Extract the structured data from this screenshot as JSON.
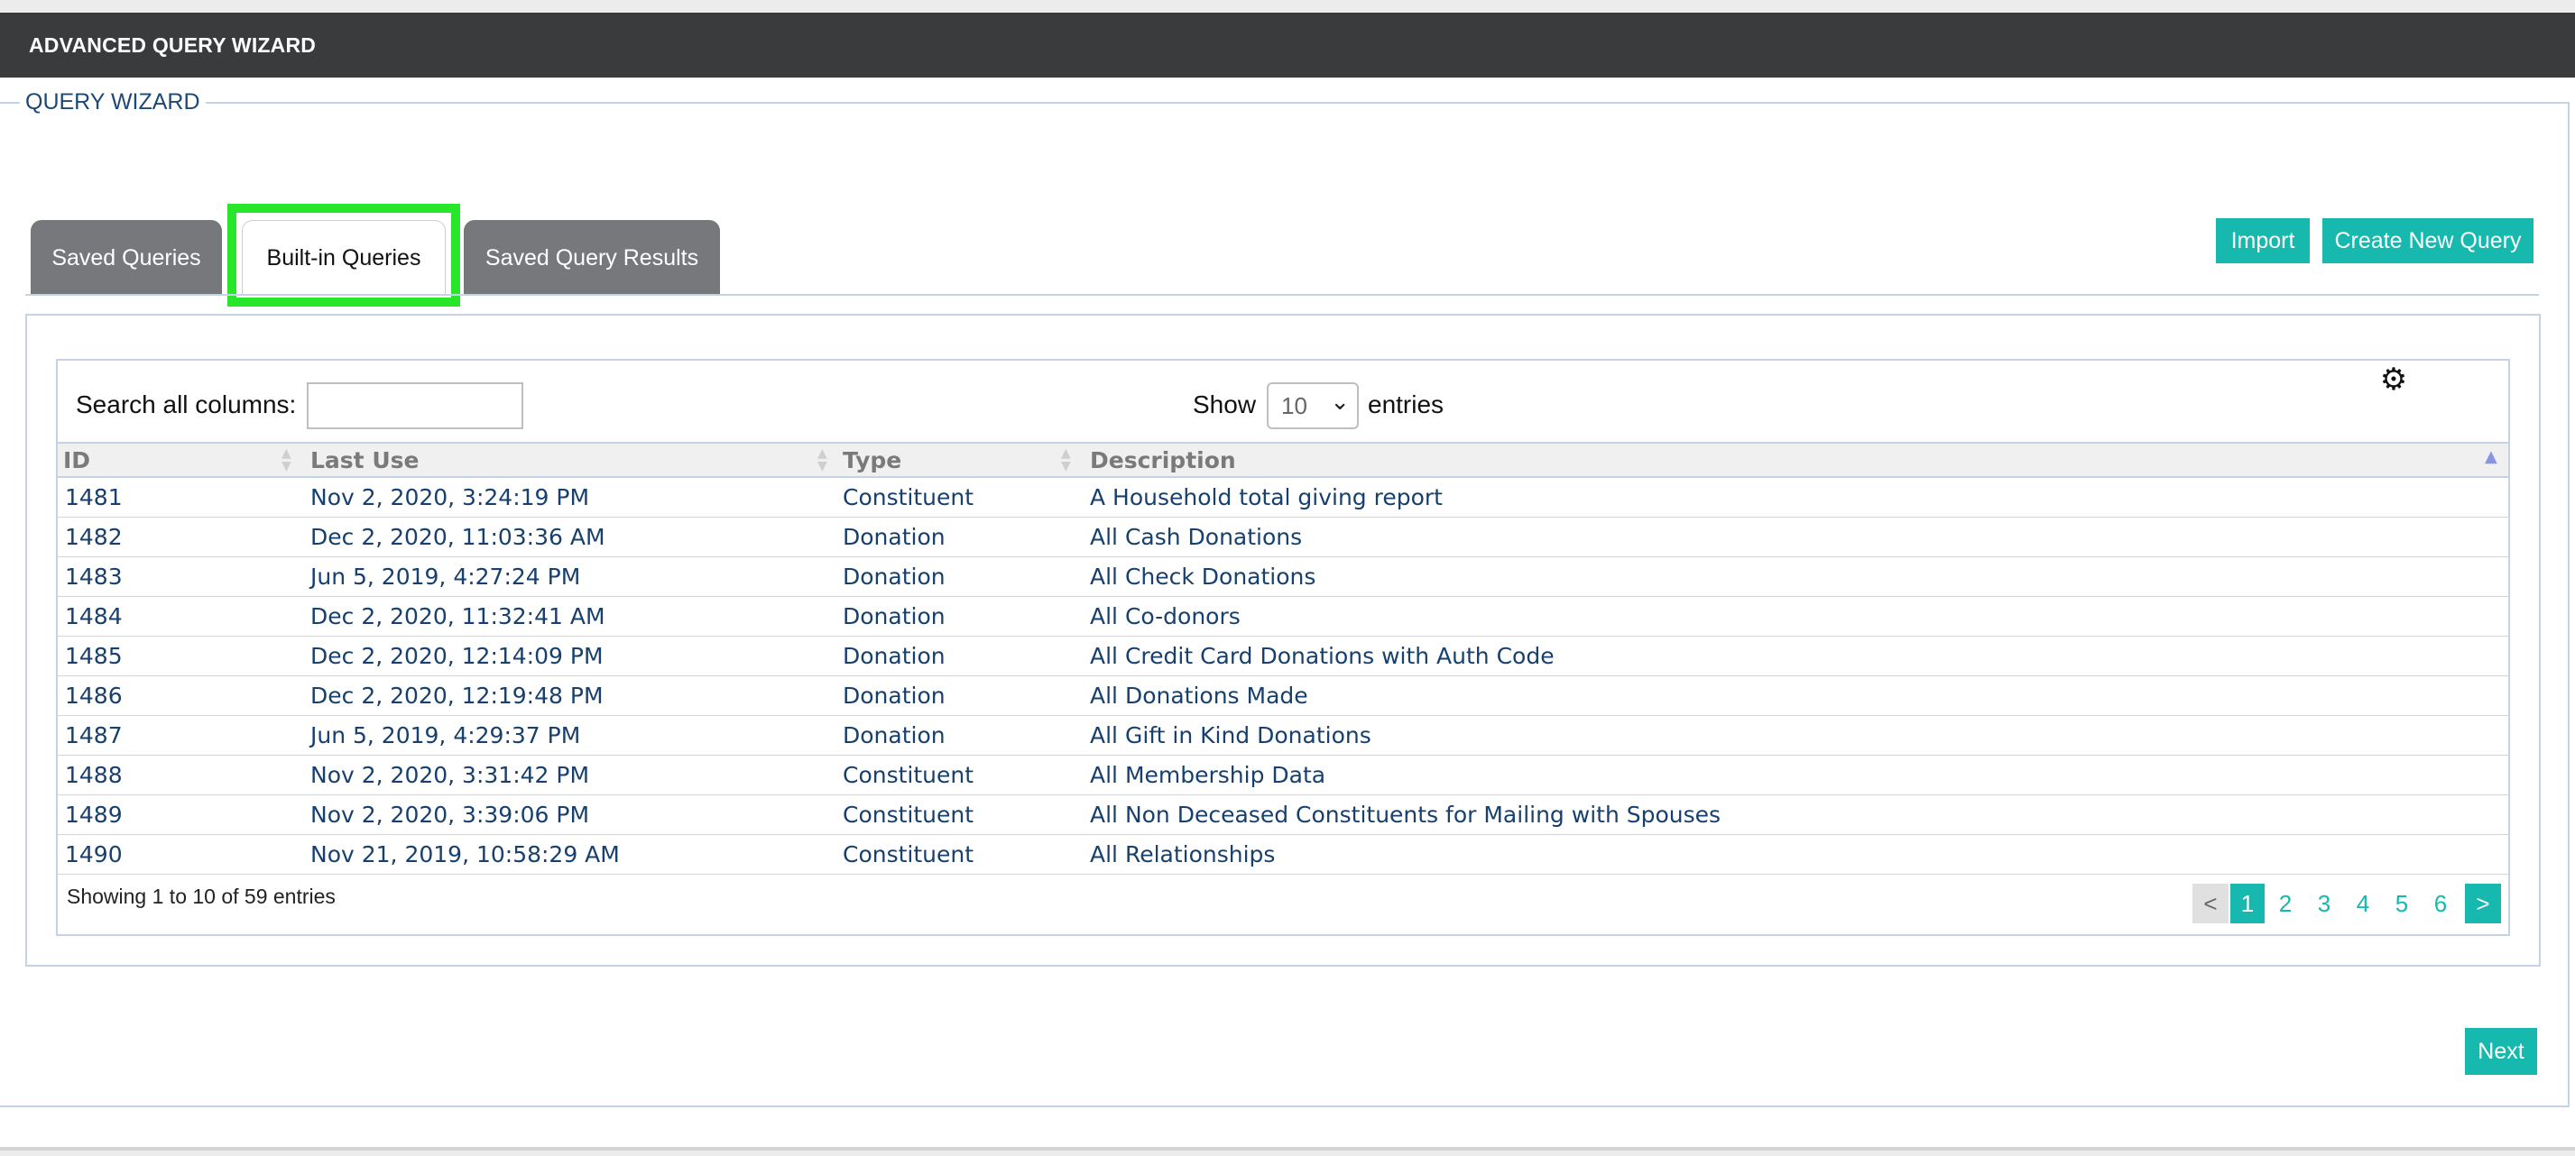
{
  "header": {
    "title": "ADVANCED QUERY WIZARD"
  },
  "wizard": {
    "legend": "QUERY WIZARD"
  },
  "tabs": [
    {
      "label": "Saved Queries",
      "active": false
    },
    {
      "label": "Built-in Queries",
      "active": true
    },
    {
      "label": "Saved Query Results",
      "active": false
    }
  ],
  "actions": {
    "import_label": "Import",
    "create_label": "Create New Query",
    "next_label": "Next"
  },
  "table_controls": {
    "search_label": "Search all columns:",
    "search_value": "",
    "show_label": "Show",
    "page_size": "10",
    "entries_label": "entries",
    "settings_icon": "gear-icon"
  },
  "table": {
    "columns": [
      "ID",
      "Last Use",
      "Type",
      "Description"
    ],
    "rows": [
      {
        "id": "1481",
        "last_use": "Nov 2, 2020, 3:24:19 PM",
        "type": "Constituent",
        "description": "A Household total giving report"
      },
      {
        "id": "1482",
        "last_use": "Dec 2, 2020, 11:03:36 AM",
        "type": "Donation",
        "description": "All Cash Donations"
      },
      {
        "id": "1483",
        "last_use": "Jun 5, 2019, 4:27:24 PM",
        "type": "Donation",
        "description": "All Check Donations"
      },
      {
        "id": "1484",
        "last_use": "Dec 2, 2020, 11:32:41 AM",
        "type": "Donation",
        "description": "All Co-donors"
      },
      {
        "id": "1485",
        "last_use": "Dec 2, 2020, 12:14:09 PM",
        "type": "Donation",
        "description": "All Credit Card Donations with Auth Code"
      },
      {
        "id": "1486",
        "last_use": "Dec 2, 2020, 12:19:48 PM",
        "type": "Donation",
        "description": "All Donations Made"
      },
      {
        "id": "1487",
        "last_use": "Jun 5, 2019, 4:29:37 PM",
        "type": "Donation",
        "description": "All Gift in Kind Donations"
      },
      {
        "id": "1488",
        "last_use": "Nov 2, 2020, 3:31:42 PM",
        "type": "Constituent",
        "description": "All Membership Data"
      },
      {
        "id": "1489",
        "last_use": "Nov 2, 2020, 3:39:06 PM",
        "type": "Constituent",
        "description": "All Non Deceased Constituents for Mailing with Spouses"
      },
      {
        "id": "1490",
        "last_use": "Nov 21, 2019, 10:58:29 AM",
        "type": "Constituent",
        "description": "All Relationships"
      }
    ],
    "info": "Showing 1 to 10 of 59 entries"
  },
  "pagination": {
    "prev": "<",
    "pages": [
      "1",
      "2",
      "3",
      "4",
      "5",
      "6"
    ],
    "current": "1",
    "next": ">"
  },
  "colors": {
    "header_bg": "#3a3b3d",
    "accent": "#17b8ad",
    "link_text": "#17406e",
    "tab_inactive": "#76787b",
    "highlight": "#28e62a"
  }
}
